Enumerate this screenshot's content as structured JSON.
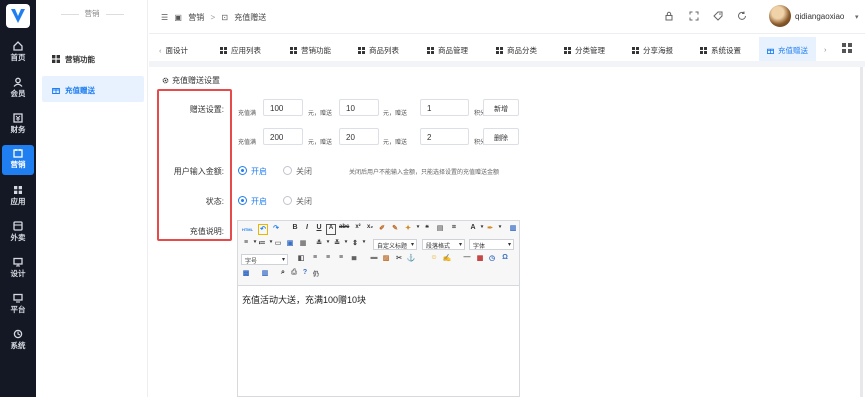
{
  "rail": {
    "items": [
      {
        "label": "首页",
        "icon": "home-icon"
      },
      {
        "label": "会员",
        "icon": "user-icon"
      },
      {
        "label": "财务",
        "icon": "finance-icon"
      },
      {
        "label": "营销",
        "icon": "marketing-icon",
        "active": true
      },
      {
        "label": "应用",
        "icon": "apps-icon"
      },
      {
        "label": "外卖",
        "icon": "takeout-icon"
      },
      {
        "label": "设计",
        "icon": "design-icon"
      },
      {
        "label": "平台",
        "icon": "platform-icon"
      },
      {
        "label": "系统",
        "icon": "system-icon"
      }
    ]
  },
  "submenu": {
    "title": "营销",
    "items": [
      {
        "label": "营销功能",
        "icon": "grid-icon"
      },
      {
        "label": "充值赠送",
        "icon": "gift-icon",
        "active": true
      }
    ]
  },
  "header": {
    "crumb_root": "营销",
    "crumb_sep": ">",
    "crumb_current": "充值赠送",
    "username": "qidiangaoxiao"
  },
  "tabs": [
    {
      "label": "面设计",
      "icon": ""
    },
    {
      "label": "应用列表",
      "icon": "grid-icon"
    },
    {
      "label": "营销功能",
      "icon": "grid-icon"
    },
    {
      "label": "商品列表",
      "icon": "grid-icon"
    },
    {
      "label": "商品管理",
      "icon": "grid-icon"
    },
    {
      "label": "商品分类",
      "icon": "grid-icon"
    },
    {
      "label": "分类管理",
      "icon": "grid-icon"
    },
    {
      "label": "分享海报",
      "icon": "grid-icon"
    },
    {
      "label": "系统设置",
      "icon": "grid-icon"
    },
    {
      "label": "充值赠送",
      "icon": "gift-icon",
      "active": true
    }
  ],
  "form": {
    "section_title": "充值赠送设置",
    "gift_label": "赠送设置:",
    "rule_text": {
      "recharge": "充值满",
      "yuan": "元，赠送",
      "points": "积分"
    },
    "rules": [
      {
        "amount": "100",
        "bonus": "10",
        "points": "1",
        "action": "新增"
      },
      {
        "amount": "200",
        "bonus": "20",
        "points": "2",
        "action": "删除"
      }
    ],
    "input_amount_label": "用户输入金额:",
    "input_amount_on": "开启",
    "input_amount_off": "关闭",
    "input_amount_hint": "关闭后用户不能输入金额，只能选择设置的充值赠送金额",
    "status_label": "状态:",
    "status_on": "开启",
    "status_off": "关闭",
    "desc_label": "充值说明:",
    "editor": {
      "font_size": "字号",
      "heading": "自定义标题",
      "paragraph": "段落格式",
      "font_family": "字体",
      "content": "充值活动大送，充满100赠10块"
    }
  },
  "colors": {
    "primary": "#1f7ef0",
    "rail": "#141824",
    "highlight_border": "#e64a4a"
  }
}
